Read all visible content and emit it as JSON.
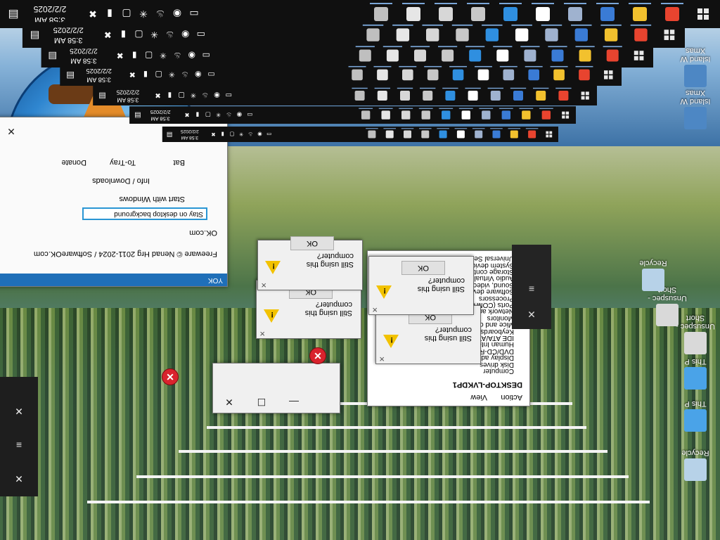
{
  "taskbar": {
    "time": "3:58 AM",
    "date": "2/2/2025",
    "start_icon": "windows-icon",
    "pinned": [
      {
        "name": "chrome-icon",
        "color": "#e8442f"
      },
      {
        "name": "folder-icon",
        "color": "#f2c12e"
      },
      {
        "name": "paint-icon",
        "color": "#3a7bd5"
      },
      {
        "name": "cloud-icon",
        "color": "#9fb2cf"
      },
      {
        "name": "snipping-icon",
        "color": "#ffffff"
      },
      {
        "name": "window-icon",
        "color": "#2f8fe0"
      },
      {
        "name": "printer-icon",
        "color": "#c8c8c8"
      },
      {
        "name": "gear-icon",
        "color": "#d7d7d7"
      },
      {
        "name": "asterisk-icon",
        "color": "#e6e6e6"
      },
      {
        "name": "generic-app-icon",
        "color": "#bfbfbf"
      }
    ],
    "tray": [
      "network-icon",
      "location-icon",
      "steam-icon",
      "asterisk-icon",
      "screen-icon",
      "battery-icon",
      "close-badge-icon"
    ]
  },
  "desktop": {
    "icons": [
      {
        "label": "Recycle",
        "color": "#b7d2e8"
      },
      {
        "label": "This P",
        "color": "#4aa3e8"
      },
      {
        "label": "This P",
        "color": "#4aa3e8"
      },
      {
        "label": "Unsuspec - Short",
        "color": "#d9d9d9"
      },
      {
        "label": "Island W Xmas",
        "color": "#4d87c4"
      },
      {
        "label": "Island W Xmas",
        "color": "#4d87c4"
      },
      {
        "label": "Unsuspec - Short",
        "color": "#d9d9d9"
      },
      {
        "label": "Recycle",
        "color": "#b7d2e8"
      }
    ]
  },
  "dialogs": [
    {
      "text": "Still using this computer?",
      "ok": "OK"
    },
    {
      "text": "Still using this computer?",
      "ok": "OK"
    },
    {
      "text": "Still using this computer?",
      "ok": "OK"
    },
    {
      "text": "Still using this computer?",
      "ok": "OK"
    }
  ],
  "glitchy_window": {
    "banner": "YOK",
    "site": "OK.com",
    "bat_label": "Bat",
    "to_tray_label": "To-Tray",
    "donate_label": "Donate",
    "links_label": "Info / Downloads",
    "start_with_windows": "Start with Windows",
    "desktop_background": "Stay on desktop background",
    "copyright": "Freeware © Nenad Hrg 2011-2024 / SoftwareOK.com"
  },
  "device_panel": {
    "title": "DESKTOP-LVKDP1",
    "items": [
      "Computer",
      "Disk drives",
      "Display adapters",
      "DVD/CD-ROM drives",
      "Human Interface Devices",
      "IDE ATA/ATAPI controllers",
      "Keyboards",
      "Mice and other pointing",
      "Monitors",
      "Network adapters",
      "Ports (COM & LPT)",
      "Processors",
      "Software devices",
      "Sound, video and game",
      "Audio Virtual Cable",
      "Storage controllers",
      "System devices",
      "Universal Serial Bus controllers"
    ],
    "action_label": "Action",
    "view_label": "View"
  },
  "window_controls": {
    "minimize": "—",
    "maximize": "☐",
    "close": "✕",
    "menu": "≡"
  },
  "colors": {
    "warning": "#f2c200",
    "error": "#d9232d",
    "accent": "#2a96d4"
  }
}
